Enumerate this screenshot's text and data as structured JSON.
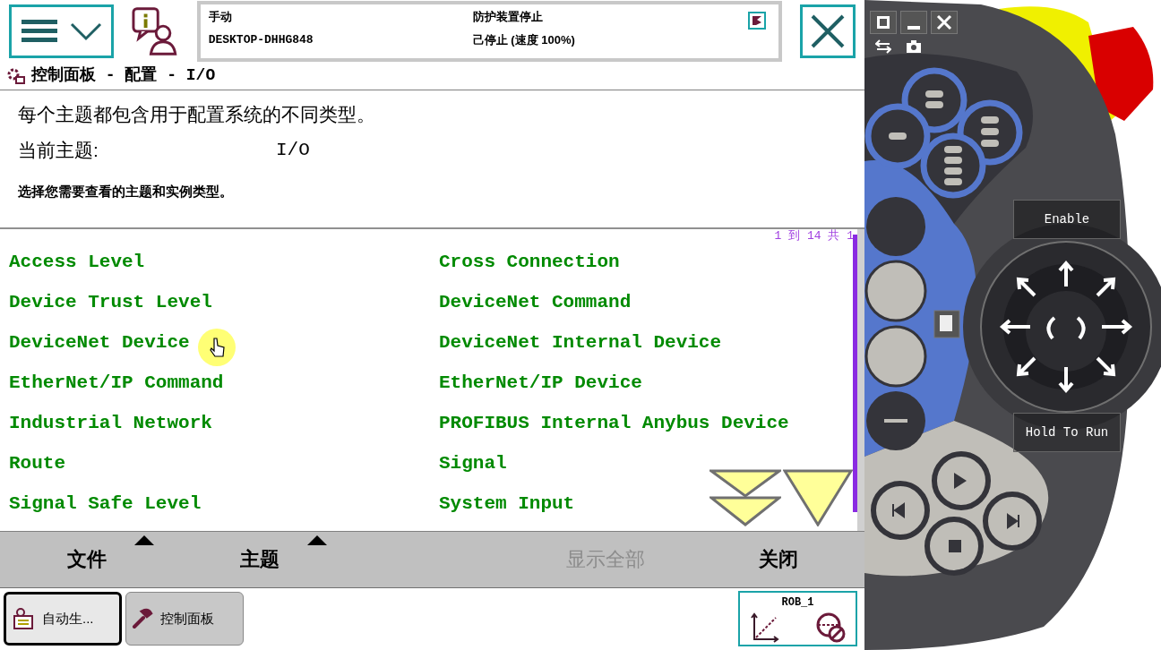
{
  "header": {
    "status": {
      "mode": "手动",
      "system": "DESKTOP-DHHG848",
      "safety": "防护装置停止",
      "state": "己停止 (速度 100%)"
    }
  },
  "breadcrumb": "控制面板 - 配置 - I/O",
  "description": "每个主题都包含用于配置系统的不同类型。",
  "current_topic": {
    "label": "当前主题:",
    "value": "I/O"
  },
  "instruction": "选择您需要查看的主题和实例类型。",
  "list": {
    "range": "1 到 14 共 1",
    "items": [
      {
        "label": "Access Level"
      },
      {
        "label": "Cross Connection"
      },
      {
        "label": "Device Trust Level"
      },
      {
        "label": "DeviceNet Command"
      },
      {
        "label": "DeviceNet Device"
      },
      {
        "label": "DeviceNet Internal Device"
      },
      {
        "label": "EtherNet/IP Command"
      },
      {
        "label": "EtherNet/IP Device"
      },
      {
        "label": "Industrial Network"
      },
      {
        "label": "PROFIBUS Internal Anybus Device"
      },
      {
        "label": "Route"
      },
      {
        "label": "Signal"
      },
      {
        "label": "Signal Safe Level"
      },
      {
        "label": "System Input"
      }
    ]
  },
  "command_bar": [
    {
      "label": "文件",
      "menu": true,
      "disabled": false
    },
    {
      "label": "主题",
      "menu": true,
      "disabled": false
    },
    {
      "label": "显示全部",
      "menu": false,
      "disabled": true
    },
    {
      "label": "关闭",
      "menu": false,
      "disabled": false
    }
  ],
  "taskbar": [
    {
      "label": "自动生...",
      "kind": "program",
      "selected": true
    },
    {
      "label": "控制面板",
      "kind": "settings",
      "selected": false
    }
  ],
  "quickset": {
    "label": "ROB_1"
  },
  "pendant": {
    "enable": "Enable",
    "hold_to_run": "Hold To Run"
  }
}
